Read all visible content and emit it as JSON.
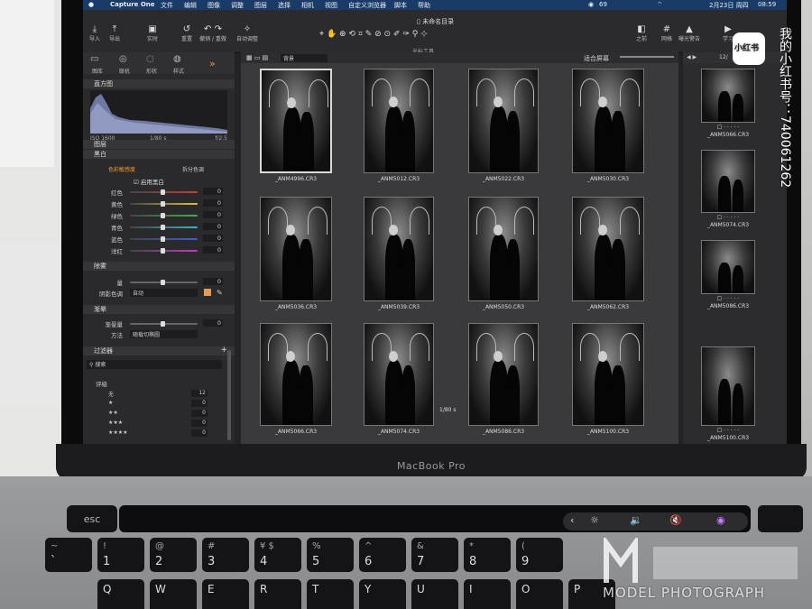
{
  "menubar": {
    "app": "Capture One",
    "items": [
      "文件",
      "编辑",
      "图像",
      "调整",
      "图层",
      "选择",
      "相机",
      "视图",
      "自定义浏览器",
      "脚本",
      "帮助"
    ],
    "battery": "69",
    "date": "2月23日 周四",
    "time": "08:59"
  },
  "window": {
    "title": "未命名目录"
  },
  "toolbar": {
    "import": "导入",
    "export": "导出",
    "live": "实时",
    "reset": "重置",
    "undo_redo": "撤销 / 重做",
    "auto_adjust": "自动调整",
    "cursor_tools": "光标工具",
    "before": "之前",
    "grid": "网格",
    "exposure_warning": "曝光警告",
    "learn": "学习"
  },
  "left_panel": {
    "tabs": [
      "图库",
      "联机",
      "形状",
      "样式"
    ],
    "histogram": {
      "title": "直方图",
      "iso": "ISO 1600",
      "shutter": "1/80 s",
      "aperture": "f/2.5"
    },
    "layers": {
      "title": "图层"
    },
    "bw": {
      "title": "黑白",
      "tab_color": "色彩敏感度",
      "tab_split": "拆分色调",
      "enable": "启用黑白",
      "rows": [
        {
          "label": "红色",
          "value": "0",
          "color": "#d23a3a"
        },
        {
          "label": "黄色",
          "value": "0",
          "color": "#d8c23a"
        },
        {
          "label": "绿色",
          "value": "0",
          "color": "#3bb34a"
        },
        {
          "label": "青色",
          "value": "0",
          "color": "#3ab3c3"
        },
        {
          "label": "蓝色",
          "value": "0",
          "color": "#3a5ed8"
        },
        {
          "label": "洋红",
          "value": "0",
          "color": "#c23ac3"
        }
      ]
    },
    "dehaze": {
      "title": "除雾",
      "amount_label": "量",
      "amount": "0",
      "tone_label": "阴影色调",
      "tone_value": "自动"
    },
    "vignette": {
      "title": "渐晕",
      "amount_label": "渐晕量",
      "amount": "0",
      "method_label": "方法",
      "method_value": "随载切椭圆"
    },
    "filter": {
      "title": "过滤器",
      "search_placeholder": "搜索",
      "rating_label": "评级",
      "rows": [
        {
          "label": "无",
          "value": "12"
        },
        {
          "label": "★",
          "value": "0"
        },
        {
          "label": "★★",
          "value": "0"
        },
        {
          "label": "★★★",
          "value": "0"
        },
        {
          "label": "★★★★",
          "value": "0"
        }
      ]
    }
  },
  "viewer": {
    "dropdown": "背景",
    "fit_label": "适合屏幕",
    "thumbs": [
      {
        "name": "_ANM4996.CR3"
      },
      {
        "name": "_ANM5012.CR3"
      },
      {
        "name": "_ANM5022.CR3"
      },
      {
        "name": "_ANM5030.CR3"
      },
      {
        "name": "_ANM5036.CR3"
      },
      {
        "name": "_ANM5039.CR3"
      },
      {
        "name": "_ANM5050.CR3"
      },
      {
        "name": "_ANM5062.CR3"
      },
      {
        "name": "_ANM5066.CR3"
      },
      {
        "name": "_ANM5074.CR3"
      },
      {
        "name": "_ANM5086.CR3"
      },
      {
        "name": "_ANM5100.CR3"
      }
    ],
    "shutter_overlay": "1/80 s"
  },
  "right_strip": {
    "page": "12/",
    "thumbs": [
      {
        "name": "_ANM5066.CR3"
      },
      {
        "name": "_ANM5074.CR3"
      },
      {
        "name": "_ANM5086.CR3"
      },
      {
        "name": "_ANM5100.CR3"
      }
    ]
  },
  "laptop": {
    "brand": "MacBook Pro",
    "esc": "esc"
  },
  "keyboard": {
    "top_row": [
      {
        "t": "~",
        "b": "`"
      },
      {
        "t": "!",
        "b": "1"
      },
      {
        "t": "@",
        "b": "2"
      },
      {
        "t": "#",
        "b": "3"
      },
      {
        "t": "¥ $",
        "b": "4"
      },
      {
        "t": "%",
        "b": "5"
      },
      {
        "t": "^",
        "b": "6"
      },
      {
        "t": "&",
        "b": "7"
      },
      {
        "t": "*",
        "b": "8"
      },
      {
        "t": "(",
        "b": "9"
      }
    ],
    "qwerty": [
      "Q",
      "W",
      "E",
      "R",
      "T",
      "Y",
      "U",
      "I",
      "O",
      "P"
    ]
  },
  "overlay": {
    "xhs_badge": "小红书",
    "xhs_id": "我的小红书号：740061262",
    "watermark_en": "MODEL PHOTOGRAPH"
  }
}
